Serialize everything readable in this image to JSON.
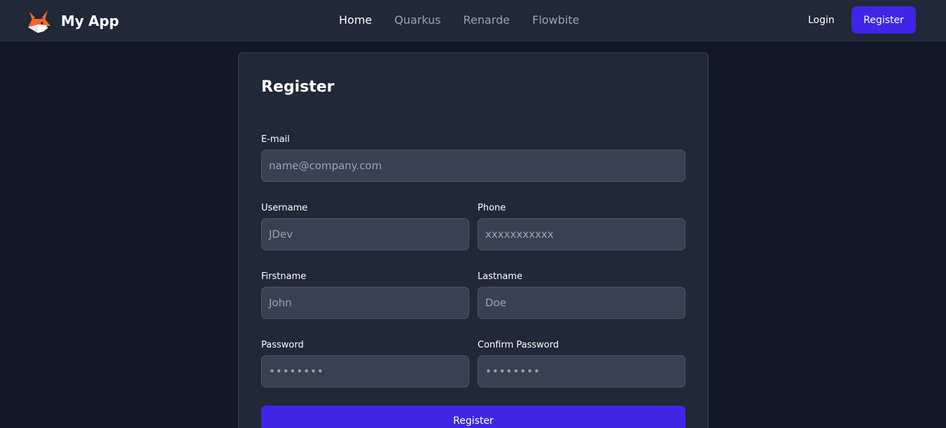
{
  "header": {
    "brand_name": "My App",
    "nav": [
      {
        "label": "Home",
        "active": true
      },
      {
        "label": "Quarkus",
        "active": false
      },
      {
        "label": "Renarde",
        "active": false
      },
      {
        "label": "Flowbite",
        "active": false
      }
    ],
    "login_label": "Login",
    "register_label": "Register"
  },
  "form": {
    "title": "Register",
    "email": {
      "label": "E-mail",
      "placeholder": "name@company.com"
    },
    "username": {
      "label": "Username",
      "placeholder": "JDev"
    },
    "phone": {
      "label": "Phone",
      "placeholder": "xxxxxxxxxxx"
    },
    "firstname": {
      "label": "Firstname",
      "placeholder": "John"
    },
    "lastname": {
      "label": "Lastname",
      "placeholder": "Doe"
    },
    "password": {
      "label": "Password",
      "placeholder": "••••••••"
    },
    "confirm_password": {
      "label": "Confirm Password",
      "placeholder": "••••••••"
    },
    "submit_label": "Register"
  },
  "colors": {
    "background": "#111827",
    "surface": "#1f2937",
    "input": "#374151",
    "accent": "#3f26e6",
    "logo_orange": "#f26a24"
  },
  "icons": {
    "logo": "fox-logo-icon"
  }
}
